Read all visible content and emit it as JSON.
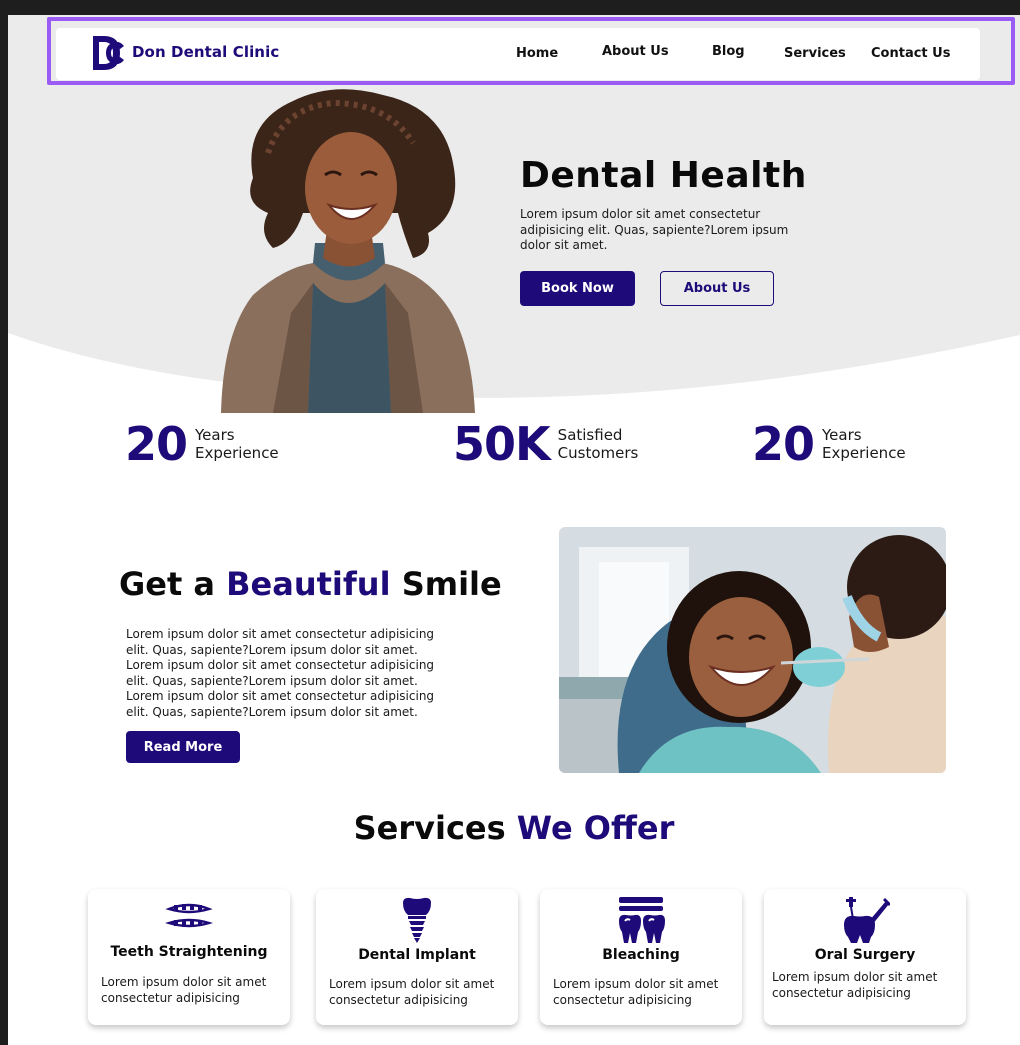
{
  "brand": {
    "name": "Don Dental Clinic",
    "logo_icon": "dc-monogram-icon"
  },
  "nav": {
    "items": [
      {
        "label": "Home"
      },
      {
        "label": "About Us"
      },
      {
        "label": "Blog"
      },
      {
        "label": "Services"
      },
      {
        "label": "Contact Us"
      }
    ]
  },
  "hero": {
    "title": "Dental Health",
    "text": "Lorem ipsum dolor sit amet consectetur adipisicing elit. Quas, sapiente?Lorem ipsum dolor sit amet.",
    "primary_button": "Book Now",
    "secondary_button": "About Us"
  },
  "stats": [
    {
      "value": "20",
      "label_line1": "Years",
      "label_line2": "Experience"
    },
    {
      "value": "50K",
      "label_line1": "Satisfied",
      "label_line2": "Customers"
    },
    {
      "value": "20",
      "label_line1": "Years",
      "label_line2": "Experience"
    }
  ],
  "smile": {
    "title_pre": "Get a ",
    "title_accent": "Beautiful",
    "title_post": " Smile",
    "text": "Lorem ipsum dolor sit amet consectetur adipisicing elit. Quas, sapiente?Lorem ipsum dolor sit amet. Lorem ipsum dolor sit amet consectetur adipisicing elit. Quas, sapiente?Lorem ipsum dolor sit amet. Lorem ipsum dolor sit amet consectetur adipisicing elit. Quas, sapiente?Lorem ipsum dolor sit amet.",
    "button": "Read More"
  },
  "services": {
    "title_pre": "Services ",
    "title_accent": "We Offer",
    "cards": [
      {
        "title": "Teeth Straightening",
        "text": "Lorem ipsum dolor sit amet consectetur adipisicing",
        "icon": "braces-icon"
      },
      {
        "title": "Dental Implant",
        "text": "Lorem ipsum dolor sit amet consectetur adipisicing",
        "icon": "implant-icon"
      },
      {
        "title": "Bleaching",
        "text": "Lorem ipsum dolor sit amet consectetur adipisicing",
        "icon": "bleaching-icon"
      },
      {
        "title": "Oral Surgery",
        "text": "Lorem ipsum dolor sit amet consectetur adipisicing",
        "icon": "tooth-surgery-icon"
      }
    ]
  },
  "colors": {
    "accent": "#1e0a78",
    "hero_bg": "#ebebeb",
    "selection": "#9b5cf6"
  }
}
